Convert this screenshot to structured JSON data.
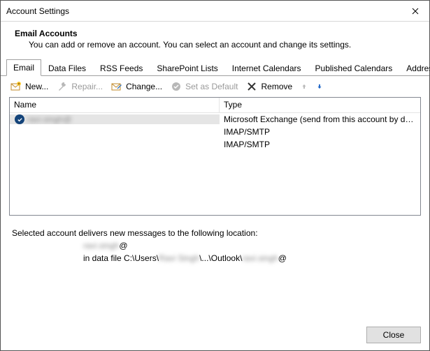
{
  "window": {
    "title": "Account Settings"
  },
  "header": {
    "title": "Email Accounts",
    "subtitle": "You can add or remove an account. You can select an account and change its settings."
  },
  "tabs": [
    {
      "label": "Email",
      "active": true
    },
    {
      "label": "Data Files"
    },
    {
      "label": "RSS Feeds"
    },
    {
      "label": "SharePoint Lists"
    },
    {
      "label": "Internet Calendars"
    },
    {
      "label": "Published Calendars"
    },
    {
      "label": "Address Books"
    }
  ],
  "toolbar": {
    "new": {
      "label": "New...",
      "icon": "mail-new-icon",
      "enabled": true
    },
    "repair": {
      "label": "Repair...",
      "icon": "wrench-icon",
      "enabled": false
    },
    "change": {
      "label": "Change...",
      "icon": "mail-change-icon",
      "enabled": true
    },
    "setdefault": {
      "label": "Set as Default",
      "icon": "check-circle-icon",
      "enabled": false
    },
    "remove": {
      "label": "Remove",
      "icon": "x-icon",
      "enabled": true
    },
    "moveup": {
      "icon": "arrow-up-icon",
      "enabled": false
    },
    "movedown": {
      "icon": "arrow-down-icon",
      "enabled": true
    }
  },
  "columns": {
    "name": "Name",
    "type": "Type"
  },
  "accounts": [
    {
      "name": "ravi.singh@",
      "name_redacted": true,
      "type": "Microsoft Exchange (send from this account by def...",
      "default": true,
      "selected": true
    },
    {
      "name": "",
      "type": "IMAP/SMTP"
    },
    {
      "name": "",
      "type": "IMAP/SMTP"
    }
  ],
  "delivery": {
    "caption": "Selected account delivers new messages to the following location:",
    "line1_prefix": "",
    "line1_redacted": "ravi.singh",
    "line1_suffix": "@",
    "line2_prefix": "in data file C:\\Users\\",
    "line2_mid_redacted": "Ravi Singh",
    "line2_mid": "\\...\\Outlook\\",
    "line2_end_redacted": "ravi.singh",
    "line2_suffix": "@"
  },
  "footer": {
    "close": "Close"
  }
}
